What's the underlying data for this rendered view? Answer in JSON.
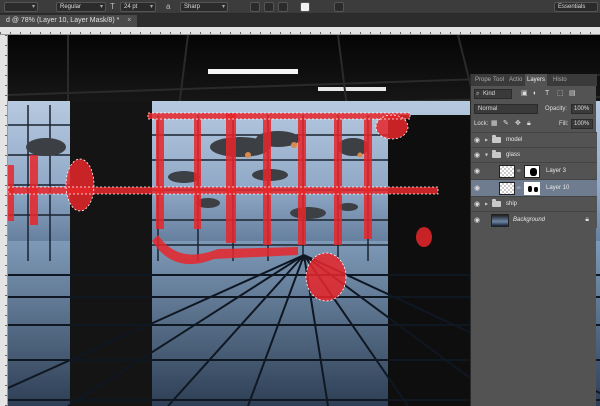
{
  "options_bar": {
    "font_style": "Regular",
    "font_size": "24 pt",
    "anti_alias": "Sharp",
    "workspace": "Essentials"
  },
  "document": {
    "tab_title": "d @ 78% (Layer 10, Layer Mask/8) *",
    "close_glyph": "×"
  },
  "layers_panel": {
    "tabs": [
      "Prope",
      "Tool",
      "Actio",
      "Layers",
      "Histo"
    ],
    "active_tab": "Layers",
    "kind_label": "Kind",
    "blend_mode": "Normal",
    "opacity_label": "Opacity:",
    "opacity_value": "100%",
    "lock_label": "Lock:",
    "fill_label": "Fill:",
    "fill_value": "100%",
    "layers": [
      {
        "name": "model",
        "type": "group",
        "expanded": false
      },
      {
        "name": "glass",
        "type": "group",
        "expanded": true
      },
      {
        "name": "Layer 3",
        "type": "layer",
        "has_mask": true,
        "selected": false
      },
      {
        "name": "Layer 10",
        "type": "layer",
        "has_mask": true,
        "selected": true
      },
      {
        "name": "ship",
        "type": "group",
        "expanded": false
      },
      {
        "name": "Background",
        "type": "background",
        "locked": true
      }
    ]
  },
  "icons": {
    "eye": "eye-icon",
    "folder": "folder-icon",
    "link": "chain-link-icon",
    "lock": "lock-icon"
  },
  "colors": {
    "panel_bg": "#535353",
    "selected_row": "#6f7b8e",
    "selection_red": "#e8262a"
  }
}
